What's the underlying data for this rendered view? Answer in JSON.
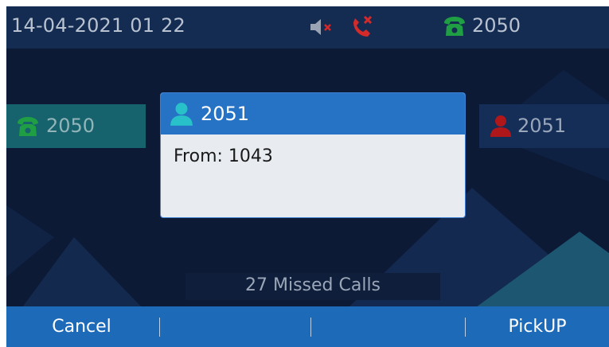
{
  "status_bar": {
    "datetime": "14-04-2021 01 22",
    "mute_icon": "speaker-muted-icon",
    "missed_call_icon": "missed-call-icon",
    "line_icon": "phone-icon",
    "line_label": "2050"
  },
  "accounts": {
    "left": {
      "icon": "phone-icon",
      "label": "2050"
    },
    "right": {
      "icon": "user-icon",
      "label": "2051"
    }
  },
  "incoming_dialog": {
    "icon": "user-icon",
    "title": "2051",
    "from_text": "From: 1043"
  },
  "missed_calls": {
    "text": "27 Missed Calls"
  },
  "softkeys": [
    {
      "label": "Cancel"
    },
    {
      "label": ""
    },
    {
      "label": ""
    },
    {
      "label": "PickUP"
    }
  ],
  "colors": {
    "screen_bg": "#0c1a36",
    "status_bar_bg": "#152c52",
    "dialog_header": "#2673c6",
    "softkey_bar": "#1d6ab8",
    "line_green": "#1f9e43",
    "user_teal": "#29c1c9",
    "user_red": "#b0171b",
    "missed_red": "#d42a2a"
  }
}
